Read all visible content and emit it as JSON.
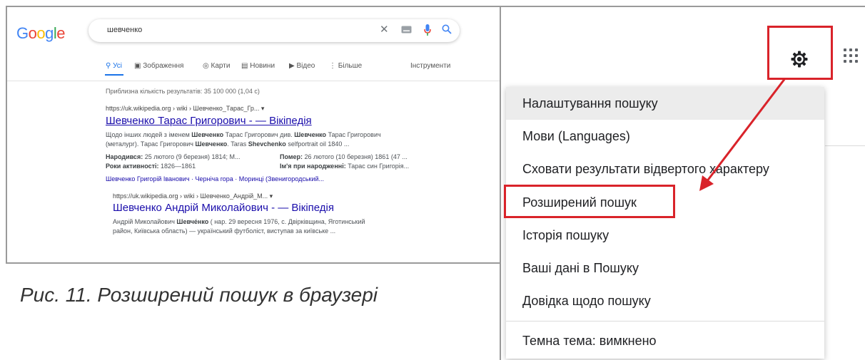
{
  "left": {
    "logo": {
      "letters": [
        "G",
        "o",
        "o",
        "g",
        "l",
        "e"
      ],
      "colors": [
        "#4285f4",
        "#ea4335",
        "#fbbc05",
        "#4285f4",
        "#34a853",
        "#ea4335"
      ]
    },
    "search": {
      "query": "шевченко",
      "clear_icon": "close-icon",
      "keyboard_icon": "keyboard-icon",
      "mic_icon": "mic-icon",
      "search_icon": "search-icon"
    },
    "tabs": [
      {
        "label": "Усі",
        "icon": "search-icon"
      },
      {
        "label": "Зображення",
        "icon": "image-icon"
      },
      {
        "label": "Карти",
        "icon": "pin-icon"
      },
      {
        "label": "Новини",
        "icon": "news-icon"
      },
      {
        "label": "Відео",
        "icon": "play-icon"
      },
      {
        "label": "Більше",
        "icon": "more-icon"
      }
    ],
    "tools": "Інструменти",
    "count": "Приблизна кількість результатів: 35 100 000 (1,04 с)",
    "results": [
      {
        "url": "https://uk.wikipedia.org › wiki › Шевченко_Тарас_Гр...  ▾",
        "title": "Шевченко Тарас Григорович - — Вікіпедія",
        "snippet1_a": "Щодо інших людей з іменем ",
        "snippet1_b": "Шевченко",
        "snippet1_c": " Тарас Григорович див. ",
        "snippet1_d": "Шевченко",
        "snippet1_e": " Тарас Григорович",
        "snippet2_a": "(металург). Тарас Григорович ",
        "snippet2_b": "Шевченко",
        "snippet2_c": ". Taras ",
        "snippet2_d": "Shevchenko",
        "snippet2_e": " selfportrait oil 1840 ...",
        "fact1_label": "Народився:",
        "fact1_value": " 25 лютого (9 березня) 1814; М...",
        "fact2_label": "Помер:",
        "fact2_value": " 26 лютого (10 березня) 1861 (47 ...",
        "fact3_label": "Роки активності:",
        "fact3_value": " 1826—1861",
        "fact4_label": "Ім'я при народженні:",
        "fact4_value": " Тарас син Григорія...",
        "links": "Шевченко Григорій Іванович · Черніча гора · Моринці (Звенигородський..."
      },
      {
        "url": "https://uk.wikipedia.org › wiki › Шевченко_Андрій_М...  ▾",
        "title": "Шевченко Андрій Миколайович - — Вікіпедія",
        "snippet1_a": "Андрій Миколайович ",
        "snippet1_b": "Шевче́нко",
        "snippet1_c": " ( нар. 29 вересня 1976, с. Двірківщина, Яготинський",
        "snippet2": "район, Київська область) — український футболіст, виступав за київське ..."
      }
    ]
  },
  "caption": "Рис. 11. Розширений пошук в браузері",
  "right": {
    "gear_icon": "gear-icon",
    "apps_icon": "apps-grid-icon",
    "menu": [
      "Налаштування пошуку",
      "Мови (Languages)",
      "Сховати результати відвертого характеру",
      "Розширений пошук",
      "Історія пошуку",
      "Ваші дані в Пошуку",
      "Довідка щодо пошуку",
      "Темна тема: вимкнено"
    ],
    "highlight_color": "#d9232a"
  }
}
